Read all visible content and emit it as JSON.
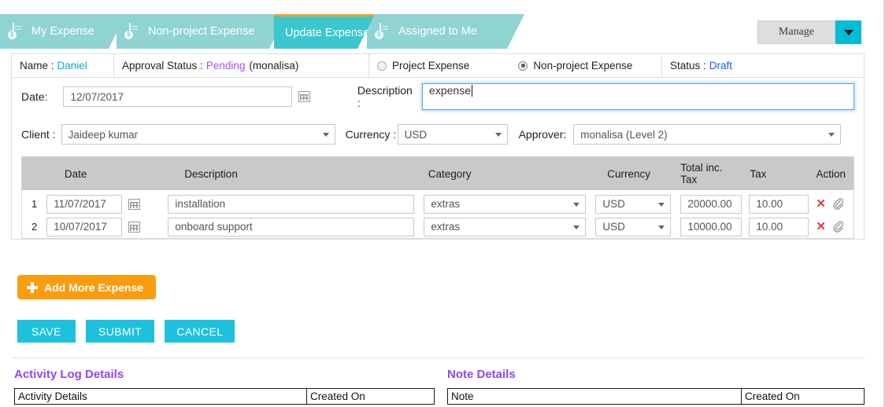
{
  "tabs": [
    {
      "label": "My Expense",
      "icon": "document-dollar-icon",
      "active": false
    },
    {
      "label": "Non-project Expense",
      "icon": "document-dollar-icon",
      "active": false
    },
    {
      "label": "Update Expense",
      "icon": "",
      "active": true
    },
    {
      "label": "Assigned to Me",
      "icon": "document-dollar-icon",
      "active": false
    }
  ],
  "toolbar": {
    "manage_label": "Manage",
    "caret_icon": "chevron-down-icon"
  },
  "infobar": {
    "name_label": "Name :",
    "name_value": "Daniel",
    "approval_label": "Approval Status :",
    "approval_value": "Pending",
    "approver_paren": "(monalisa)",
    "radio_project": "Project Expense",
    "radio_nonproject": "Non-project Expense",
    "radio_selected": "Non-project Expense",
    "status_label": "Status :",
    "status_value": "Draft"
  },
  "form": {
    "date_label": "Date:",
    "date_value": "12/07/2017",
    "calendar_icon": "calendar-icon",
    "description_label": "Description :",
    "description_value": "expense",
    "client_label": "Client :",
    "client_value": "Jaideep kumar",
    "currency_label": "Currency :",
    "currency_value": "USD",
    "approver_label": "Approver:",
    "approver_value": "monalisa (Level 2)"
  },
  "expense_table": {
    "headers": {
      "index": "",
      "date": "Date",
      "description": "Description",
      "category": "Category",
      "currency": "Currency",
      "total": "Total inc. Tax",
      "total_line1": "Total inc.",
      "total_line2": "Tax",
      "tax": "Tax",
      "action": "Action"
    },
    "rows": [
      {
        "index": "1",
        "date": "11/07/2017",
        "description": "installation",
        "category": "extras",
        "currency": "USD",
        "total": "20000.00",
        "tax": "10.00",
        "delete_icon": "close-x-icon",
        "attach_icon": "paperclip-icon"
      },
      {
        "index": "2",
        "date": "10/07/2017",
        "description": "onboard support",
        "category": "extras",
        "currency": "USD",
        "total": "10000.00",
        "tax": "10.00",
        "delete_icon": "close-x-icon",
        "attach_icon": "paperclip-icon"
      }
    ]
  },
  "actions": {
    "add_more_label": "Add More Expense",
    "add_icon": "plus-icon",
    "save_label": "SAVE",
    "submit_label": "SUBMIT",
    "cancel_label": "CANCEL"
  },
  "activity_section": {
    "title": "Activity Log Details",
    "col_details": "Activity Details",
    "col_created": "Created On"
  },
  "note_section": {
    "title": "Note Details",
    "col_note": "Note",
    "col_created": "Created On"
  },
  "colors": {
    "tab_inactive": "#8fd3d3",
    "tab_active": "#3cc6cd",
    "tab_active_top": "#f0a22e",
    "accent_cyan": "#1ec1dd",
    "accent_orange": "#fb9b0e",
    "purple": "#9046f5",
    "status_blue": "#1a5cf0",
    "name_cyan": "#00b2c9",
    "delete_red": "#e03b3b",
    "table_header_gray": "#c9c9c9"
  }
}
